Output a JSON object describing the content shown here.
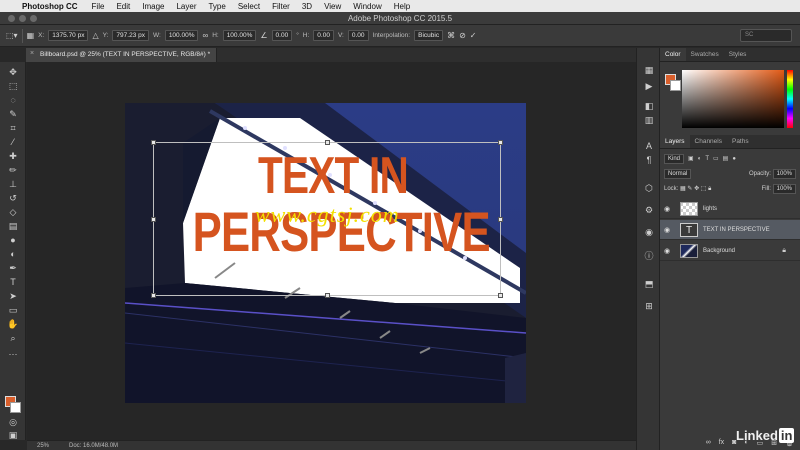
{
  "menubar": {
    "app_name": "Photoshop CC",
    "items": [
      "File",
      "Edit",
      "Image",
      "Layer",
      "Type",
      "Select",
      "Filter",
      "3D",
      "View",
      "Window",
      "Help"
    ]
  },
  "window_title": "Adobe Photoshop CC 2015.5",
  "options": {
    "x_label": "X:",
    "x_value": "1375.70 px",
    "y_label": "Y:",
    "y_value": "797.23 px",
    "w_label": "W:",
    "w_value": "100.00%",
    "h_label": "H:",
    "h_value": "100.00%",
    "angle_value": "0.00",
    "angle_unit": "°",
    "hskew_label": "H:",
    "hskew_value": "0.00",
    "vskew_label": "V:",
    "vskew_value": "0.00",
    "interpolation_label": "Interpolation:",
    "interpolation_value": "Bicubic",
    "search_placeholder": "SC"
  },
  "document": {
    "tab_title": "Billboard.psd @ 25% (TEXT IN PERSPECTIVE, RGB/8#) *",
    "close_glyph": "×"
  },
  "canvas": {
    "line1": "TEXT IN",
    "line2": "PERSPECTIVE",
    "watermark": "www.cgtsj.com"
  },
  "status": {
    "zoom": "25%",
    "doc": "Doc: 16.0M/48.0M"
  },
  "color_panel": {
    "tabs": [
      "Color",
      "Swatches",
      "Styles"
    ],
    "foreground": "#d95f2c",
    "background": "#ffffff"
  },
  "layers_panel": {
    "tabs": [
      "Layers",
      "Channels",
      "Paths"
    ],
    "filter_kind": "Kind",
    "blend_mode": "Normal",
    "opacity_label": "Opacity:",
    "opacity_value": "100%",
    "lock_label": "Lock:",
    "fill_label": "Fill:",
    "fill_value": "100%",
    "layers": [
      {
        "name": "lights",
        "selected": false
      },
      {
        "name": "TEXT IN PERSPECTIVE",
        "selected": true
      },
      {
        "name": "Background",
        "selected": false
      }
    ]
  },
  "brand": {
    "linked": "Linked",
    "in": "in"
  }
}
